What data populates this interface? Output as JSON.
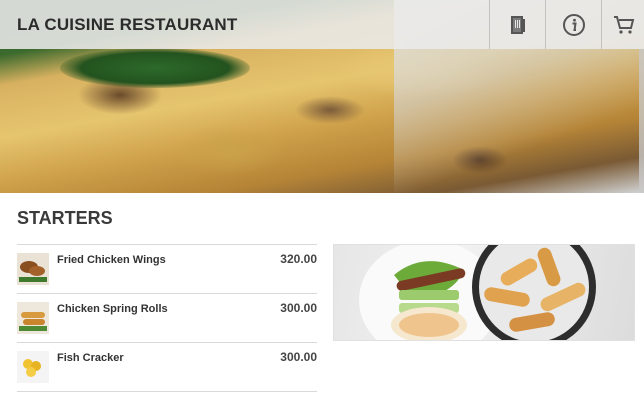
{
  "header": {
    "brand": "LA CUISINE RESTAURANT"
  },
  "starters": {
    "title": "STARTERS",
    "items": [
      {
        "name": "Fried Chicken Wings",
        "price": "320.00"
      },
      {
        "name": "Chicken Spring Rolls",
        "price": "300.00"
      },
      {
        "name": "Fish Cracker",
        "price": "300.00"
      }
    ]
  },
  "icons": {
    "menu": "menu-book-icon",
    "info": "info-icon",
    "cart": "cart-icon"
  }
}
